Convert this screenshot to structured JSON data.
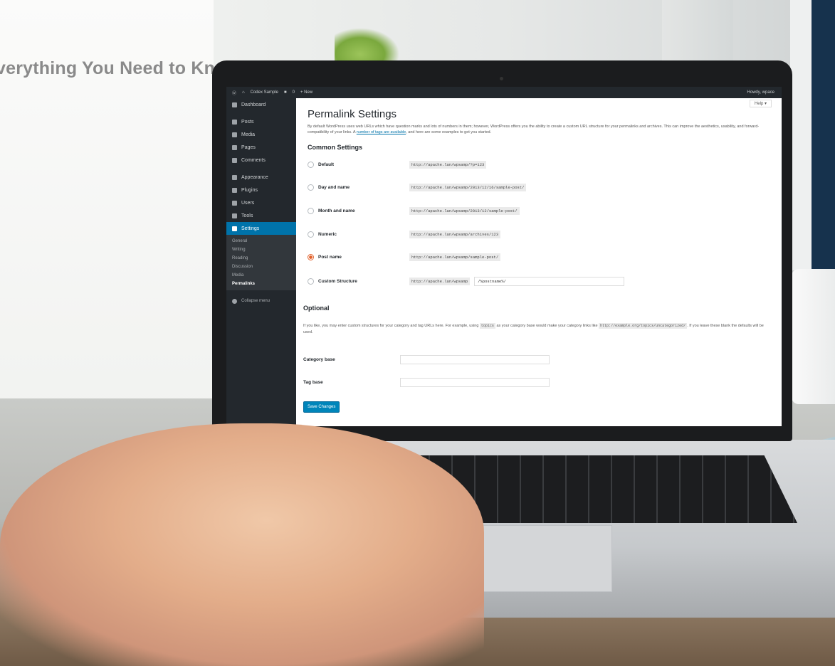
{
  "heading": "verything You Need to Know",
  "adminbar": {
    "site": "Codex Sample",
    "comments": "0",
    "new": "+ New",
    "user": "Howdy, wpace"
  },
  "sidebar": {
    "items": [
      {
        "label": "Dashboard"
      },
      {
        "label": "Posts"
      },
      {
        "label": "Media"
      },
      {
        "label": "Pages"
      },
      {
        "label": "Comments"
      },
      {
        "label": "Appearance"
      },
      {
        "label": "Plugins"
      },
      {
        "label": "Users"
      },
      {
        "label": "Tools"
      },
      {
        "label": "Settings"
      }
    ],
    "submenu": [
      "General",
      "Writing",
      "Reading",
      "Discussion",
      "Media",
      "Permalinks"
    ],
    "collapse": "Collapse menu"
  },
  "help": "Help ▾",
  "page_title": "Permalink Settings",
  "intro": {
    "text": "By default WordPress uses web URLs which have question marks and lots of numbers in them; however, WordPress offers you the ability to create a custom URL structure for your permalinks and archives. This can improve the aesthetics, usability, and forward-compatibility of your links. A",
    "link": "number of tags are available",
    "after": ", and here are some examples to get you started."
  },
  "common_heading": "Common Settings",
  "options": [
    {
      "label": "Default",
      "example": "http://apache.lan/wpsamp/?p=123",
      "checked": false
    },
    {
      "label": "Day and name",
      "example": "http://apache.lan/wpsamp/2013/12/16/sample-post/",
      "checked": false
    },
    {
      "label": "Month and name",
      "example": "http://apache.lan/wpsamp/2013/12/sample-post/",
      "checked": false
    },
    {
      "label": "Numeric",
      "example": "http://apache.lan/wpsamp/archives/123",
      "checked": false
    },
    {
      "label": "Post name",
      "example": "http://apache.lan/wpsamp/sample-post/",
      "checked": true
    },
    {
      "label": "Custom Structure",
      "example": "http://apache.lan/wpsamp",
      "value": "/%postname%/",
      "checked": false
    }
  ],
  "optional_heading": "Optional",
  "optional_text": {
    "a": "If you like, you may enter custom structures for your category and tag URLs here. For example, using",
    "code1": "topics",
    "b": "as your category base would make your category links like",
    "code2": "http://example.org/topics/uncategorized/",
    "c": ". If you leave these blank the defaults will be used."
  },
  "category_base": "Category base",
  "tag_base": "Tag base",
  "save": "Save Changes",
  "colors": {
    "accent": "#0073aa",
    "sidebar": "#23282d",
    "checked_radio": "#e2622c"
  }
}
